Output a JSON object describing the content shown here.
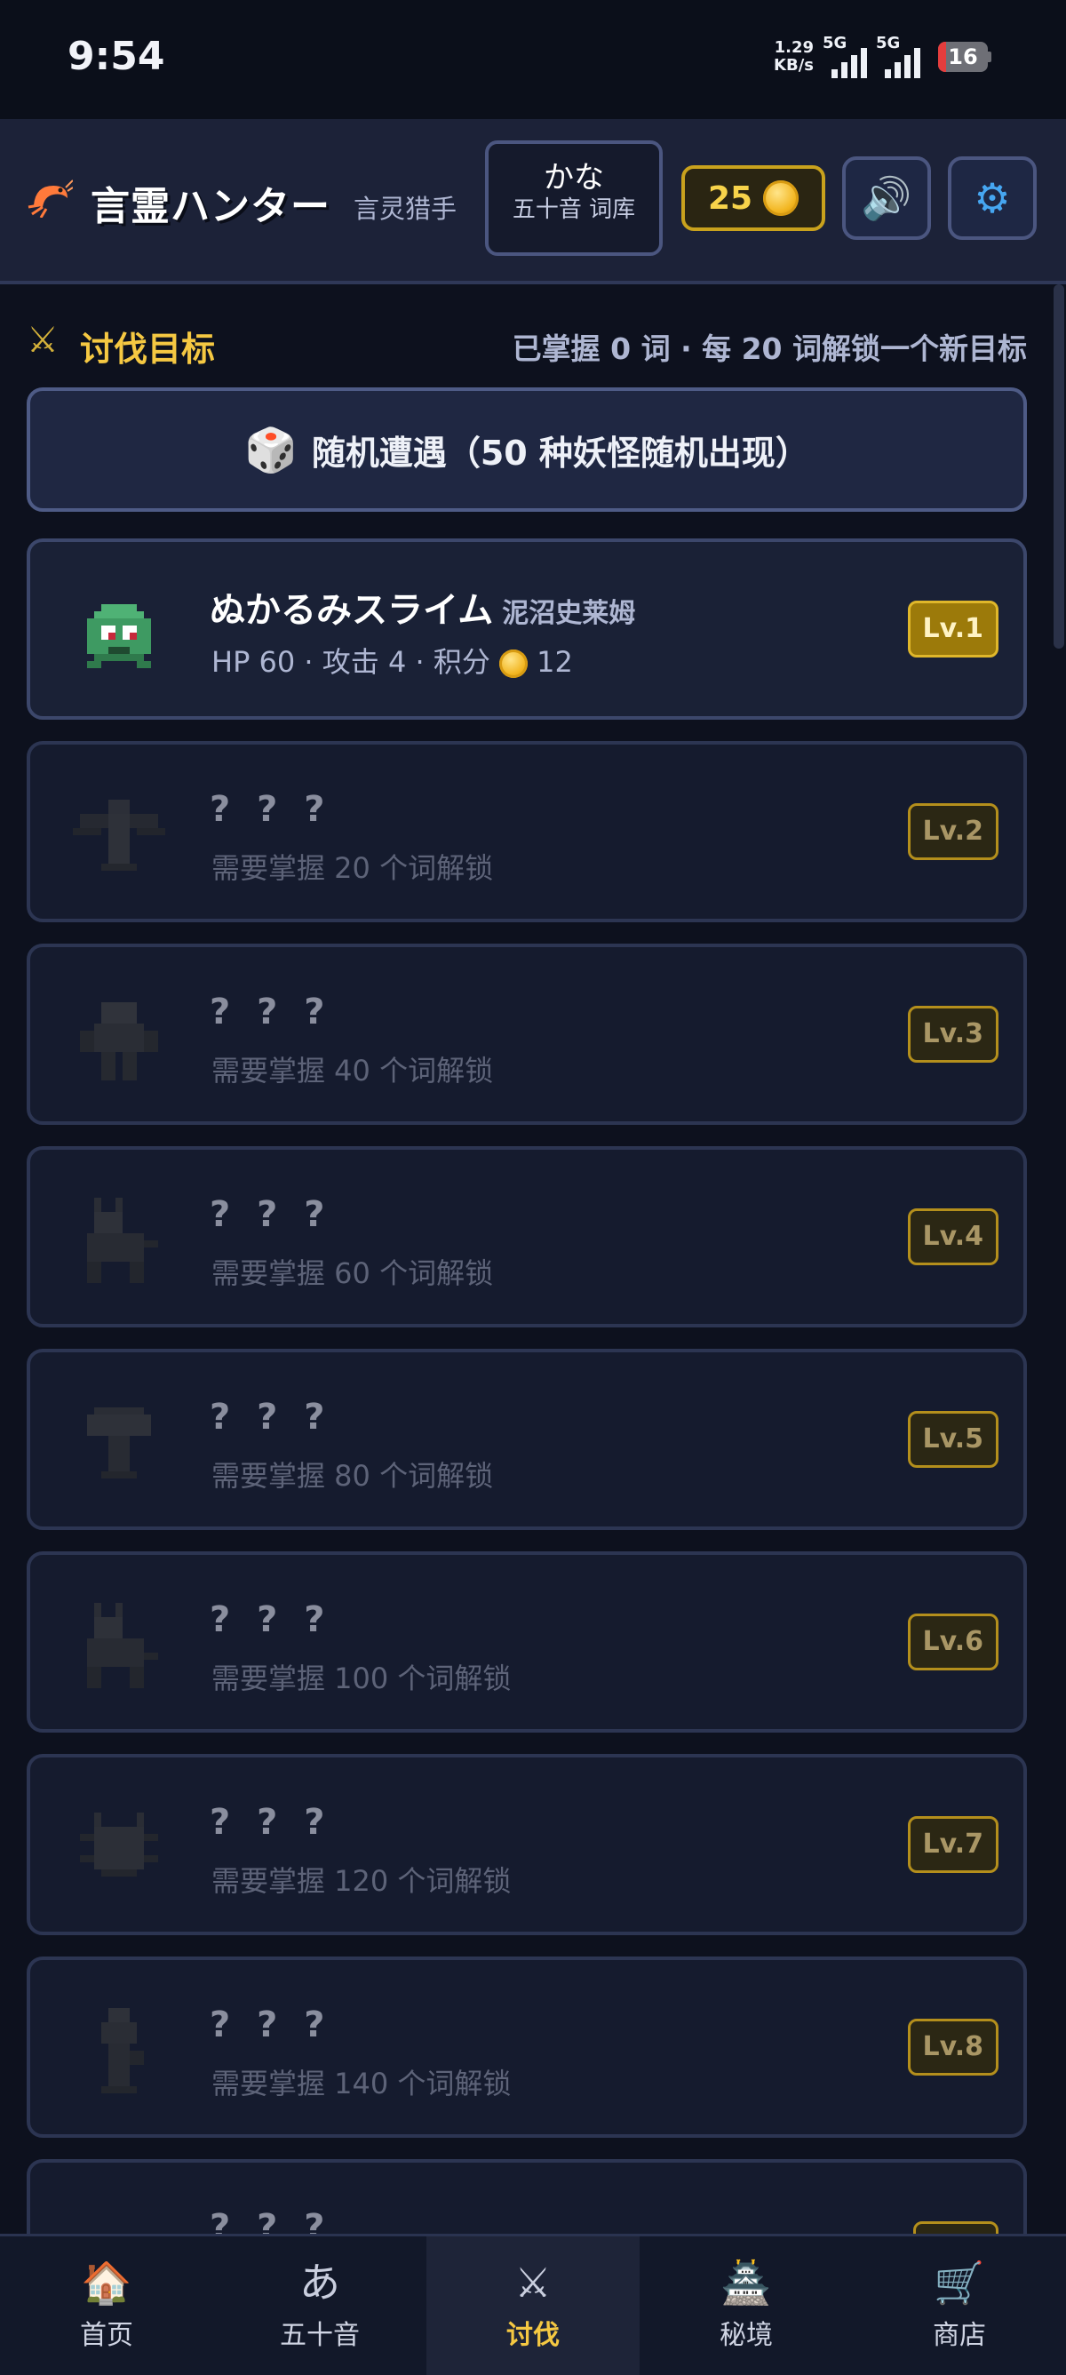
{
  "status_bar": {
    "time": "9:54",
    "net_speed_value": "1.29",
    "net_speed_unit": "KB/s",
    "signal1_label": "5G",
    "signal2_label": "5G",
    "battery": "16"
  },
  "header": {
    "app_title": "言霊ハンター",
    "app_subtitle": "言灵猎手",
    "deck_kana": "かな",
    "deck_name": "五十音 词库",
    "coins": "25",
    "icons": {
      "logo": "shrimp-icon",
      "coin": "coin-icon",
      "sound": "speaker-icon",
      "settings": "gear-icon"
    }
  },
  "section": {
    "title": "讨伐目标",
    "progress": "已掌握 0 词 · 每 20 词解锁一个新目标"
  },
  "random_encounter": {
    "label": "随机遭遇（50 种妖怪随机出现）"
  },
  "monsters": [
    {
      "name": "ぬかるみスライム",
      "name_cn": "泥沼史莱姆",
      "stats_prefix": "HP 60 · 攻击 4 · 积分",
      "score": "12",
      "level": "Lv.1",
      "locked": false
    },
    {
      "name": "? ? ?",
      "hint": "需要掌握 20 个词解锁",
      "level": "Lv.2",
      "locked": true
    },
    {
      "name": "? ? ?",
      "hint": "需要掌握 40 个词解锁",
      "level": "Lv.3",
      "locked": true
    },
    {
      "name": "? ? ?",
      "hint": "需要掌握 60 个词解锁",
      "level": "Lv.4",
      "locked": true
    },
    {
      "name": "? ? ?",
      "hint": "需要掌握 80 个词解锁",
      "level": "Lv.5",
      "locked": true
    },
    {
      "name": "? ? ?",
      "hint": "需要掌握 100 个词解锁",
      "level": "Lv.6",
      "locked": true
    },
    {
      "name": "? ? ?",
      "hint": "需要掌握 120 个词解锁",
      "level": "Lv.7",
      "locked": true
    },
    {
      "name": "? ? ?",
      "hint": "需要掌握 140 个词解锁",
      "level": "Lv.8",
      "locked": true
    },
    {
      "name": "? ? ?",
      "locked": true
    }
  ],
  "nav": {
    "items": [
      {
        "label": "首页",
        "icon": "house-icon"
      },
      {
        "label": "五十音",
        "icon": "あ"
      },
      {
        "label": "讨伐",
        "icon": "crossed-swords-icon"
      },
      {
        "label": "秘境",
        "icon": "castle-icon"
      },
      {
        "label": "商店",
        "icon": "cart-icon"
      }
    ],
    "active": "讨伐"
  },
  "colors": {
    "accent_gold": "#f5c842",
    "background": "#0d111e",
    "card": "#151b2e",
    "slime_green": "#3e9a62"
  }
}
